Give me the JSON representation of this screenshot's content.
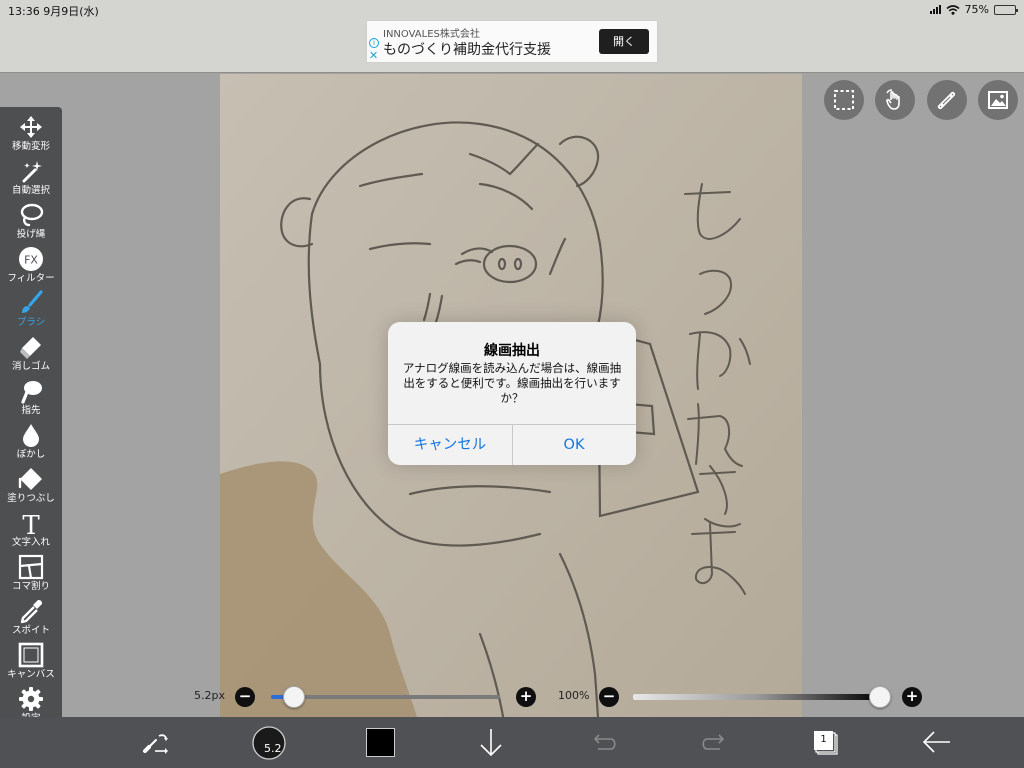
{
  "status_bar": {
    "time_date": "13:36   9月9日(水)",
    "battery": "75%",
    "battery_level": 0.75
  },
  "ad": {
    "company": "INNOVALES株式会社",
    "headline": "ものづくり補助金代行支援",
    "open_label": "開く",
    "info_icon": "info-icon",
    "close_icon": "close-icon"
  },
  "tools": [
    {
      "label": "移動変形",
      "icon": "move-icon"
    },
    {
      "label": "自動選択",
      "icon": "magic-wand-icon"
    },
    {
      "label": "投げ縄",
      "icon": "lasso-icon"
    },
    {
      "label": "フィルター",
      "icon": "fx-icon",
      "icon_text": "FX"
    },
    {
      "label": "ブラシ",
      "icon": "brush-icon",
      "active": true
    },
    {
      "label": "消しゴム",
      "icon": "eraser-icon"
    },
    {
      "label": "指先",
      "icon": "smudge-icon"
    },
    {
      "label": "ぼかし",
      "icon": "blur-drop-icon"
    },
    {
      "label": "塗りつぶし",
      "icon": "bucket-icon"
    },
    {
      "label": "文字入れ",
      "icon": "text-icon",
      "icon_text": "T"
    },
    {
      "label": "コマ割り",
      "icon": "panel-icon"
    },
    {
      "label": "スポイト",
      "icon": "eyedropper-icon"
    },
    {
      "label": "キャンバス",
      "icon": "canvas-icon"
    },
    {
      "label": "設定",
      "icon": "gear-icon"
    }
  ],
  "top_right_buttons": [
    "selection-icon",
    "hand-icon",
    "ruler-icon",
    "material-icon"
  ],
  "brush_size": {
    "label": "5.2px",
    "value": 5.2
  },
  "opacity": {
    "label": "100%",
    "value": 100
  },
  "bottom_bar": {
    "brush_size_badge": "5.2",
    "color": "#000000",
    "layer_count": "1"
  },
  "dialog": {
    "title": "線画抽出",
    "message": "アナログ線画を読み込んだ場合は、線画抽出をすると便利です。線画抽出を行いますか？",
    "cancel_label": "キャンセル",
    "ok_label": "OK"
  },
  "drawing": {
    "handwritten_text": "おつかれさま"
  }
}
